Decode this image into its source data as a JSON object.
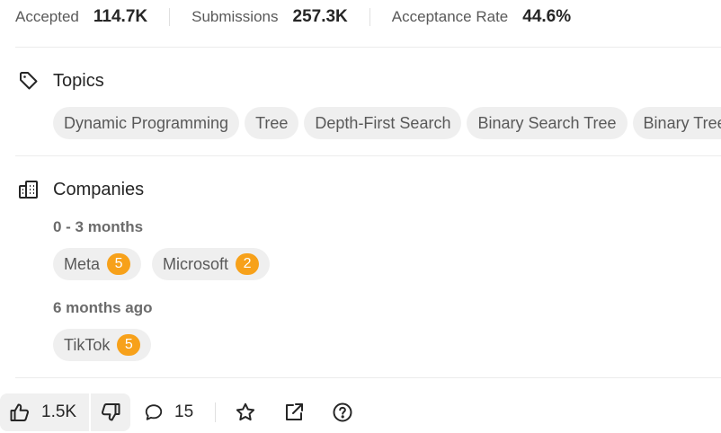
{
  "stats": [
    {
      "label": "Accepted",
      "value": "114.7K"
    },
    {
      "label": "Submissions",
      "value": "257.3K"
    },
    {
      "label": "Acceptance Rate",
      "value": "44.6%"
    }
  ],
  "topics": {
    "title": "Topics",
    "icon": "tag-icon",
    "tags": [
      "Dynamic Programming",
      "Tree",
      "Depth-First Search",
      "Binary Search Tree",
      "Binary Tree"
    ]
  },
  "companies": {
    "title": "Companies",
    "icon": "building-icon",
    "groups": [
      {
        "period": "0 - 3 months",
        "items": [
          {
            "name": "Meta",
            "count": "5"
          },
          {
            "name": "Microsoft",
            "count": "2"
          }
        ]
      },
      {
        "period": "6 months ago",
        "items": [
          {
            "name": "TikTok",
            "count": "5"
          }
        ]
      }
    ]
  },
  "actions": {
    "likes": "1.5K",
    "comments": "15"
  },
  "colors": {
    "badge": "#f7a11a",
    "chip_bg": "#efefef",
    "text": "#262626",
    "muted": "#595959"
  }
}
